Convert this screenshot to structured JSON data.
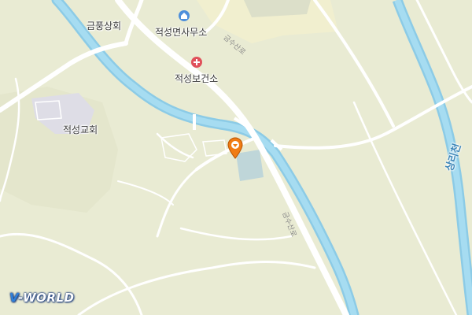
{
  "map": {
    "places": [
      {
        "id": "geumpung",
        "label": "금풍상회"
      },
      {
        "id": "office",
        "label": "적성면사무소"
      },
      {
        "id": "health",
        "label": "적성보건소"
      },
      {
        "id": "church",
        "label": "적성교회"
      }
    ],
    "roads": [
      {
        "id": "road1",
        "label": "금수산로"
      },
      {
        "id": "road2",
        "label": "금수산로"
      }
    ],
    "river": {
      "label": "상리천"
    },
    "icons": {
      "office": "government-building-icon",
      "health": "medical-cross-icon",
      "marker": "location-pin-icon"
    },
    "colors": {
      "land": "#e9ebd3",
      "road": "#ffffff",
      "water": "#9ed7ef",
      "marker": "#f07c14"
    },
    "logo": {
      "prefix": "V",
      "suffix": "-WORLD"
    }
  }
}
